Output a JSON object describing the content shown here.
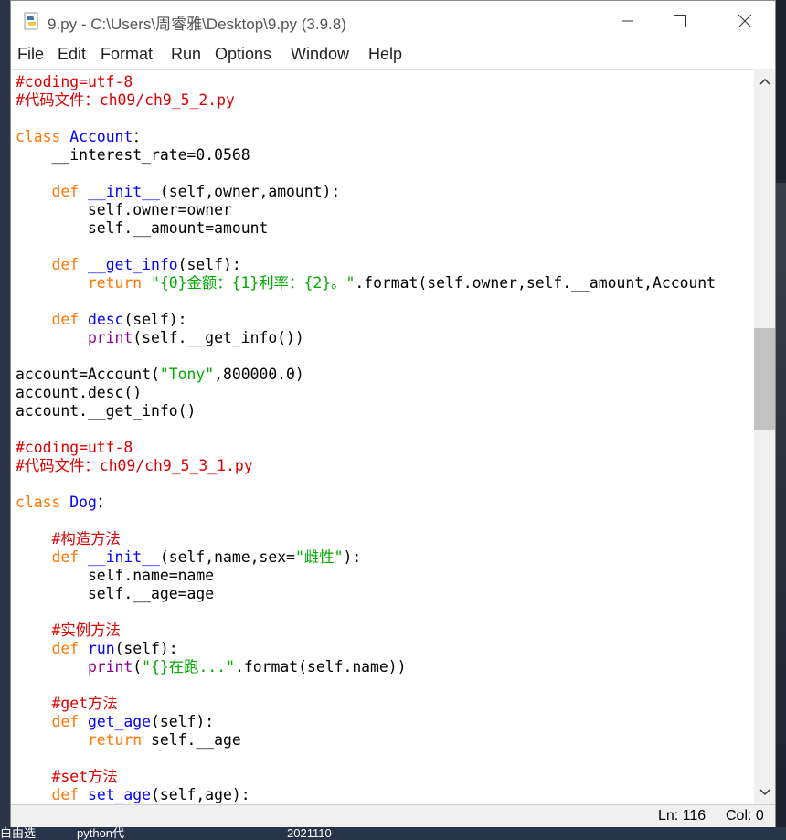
{
  "window": {
    "title": "9.py - C:\\Users\\周睿雅\\Desktop\\9.py (3.9.8)"
  },
  "menu": [
    "File",
    "Edit",
    "Format",
    "Run",
    "Options",
    "Window",
    "Help"
  ],
  "status": {
    "line": "Ln: 116",
    "col": "Col: 0"
  },
  "taskbar": {
    "items": [
      "白由选",
      "python代",
      "2021110"
    ]
  },
  "code_lines": [
    [
      [
        "cm",
        "#coding=utf-8"
      ]
    ],
    [
      [
        "cm",
        "#代码文件：ch09/ch9_5_2.py"
      ]
    ],
    [],
    [
      [
        "kw",
        "class "
      ],
      [
        "df",
        "Account"
      ],
      [
        "",
        "："
      ]
    ],
    [
      [
        "",
        "    __interest_rate=0.0568"
      ]
    ],
    [],
    [
      [
        "kw",
        "    def "
      ],
      [
        "df",
        "__init__"
      ],
      [
        "",
        "(self,owner,amount):"
      ]
    ],
    [
      [
        "",
        "        self.owner=owner"
      ]
    ],
    [
      [
        "",
        "        self.__amount=amount"
      ]
    ],
    [],
    [
      [
        "kw",
        "    def "
      ],
      [
        "df",
        "__get_info"
      ],
      [
        "",
        "(self):"
      ]
    ],
    [
      [
        "kw",
        "        return "
      ],
      [
        "st",
        "\"{0}金额：{1}利率：{2}。\""
      ],
      [
        "",
        ".format(self.owner,self.__amount,Account"
      ]
    ],
    [],
    [
      [
        "kw",
        "    def "
      ],
      [
        "df",
        "desc"
      ],
      [
        "",
        "(self):"
      ]
    ],
    [
      [
        "bi",
        "        print"
      ],
      [
        "",
        "(self.__get_info())"
      ]
    ],
    [],
    [
      [
        "",
        "account=Account("
      ],
      [
        "st",
        "\"Tony\""
      ],
      [
        "",
        ",800000.0)"
      ]
    ],
    [
      [
        "",
        "account.desc()"
      ]
    ],
    [
      [
        "",
        "account.__get_info()"
      ]
    ],
    [],
    [
      [
        "cm",
        "#coding=utf-8"
      ]
    ],
    [
      [
        "cm",
        "#代码文件：ch09/ch9_5_3_1.py"
      ]
    ],
    [],
    [
      [
        "kw",
        "class "
      ],
      [
        "df",
        "Dog"
      ],
      [
        "",
        "："
      ]
    ],
    [],
    [
      [
        "cm",
        "    #构造方法"
      ]
    ],
    [
      [
        "kw",
        "    def "
      ],
      [
        "df",
        "__init__"
      ],
      [
        "",
        "(self,name,sex="
      ],
      [
        "st",
        "\"雌性\""
      ],
      [
        "",
        "):"
      ]
    ],
    [
      [
        "",
        "        self.name=name"
      ]
    ],
    [
      [
        "",
        "        self.__age=age"
      ]
    ],
    [],
    [
      [
        "cm",
        "    #实例方法"
      ]
    ],
    [
      [
        "kw",
        "    def "
      ],
      [
        "df",
        "run"
      ],
      [
        "",
        "(self):"
      ]
    ],
    [
      [
        "bi",
        "        print"
      ],
      [
        "",
        "("
      ],
      [
        "st",
        "\"{}在跑...\""
      ],
      [
        "",
        ".format(self.name))"
      ]
    ],
    [],
    [
      [
        "cm",
        "    #get方法"
      ]
    ],
    [
      [
        "kw",
        "    def "
      ],
      [
        "df",
        "get_age"
      ],
      [
        "",
        "(self):"
      ]
    ],
    [
      [
        "kw",
        "        return "
      ],
      [
        "",
        "self.__age"
      ]
    ],
    [],
    [
      [
        "cm",
        "    #set方法"
      ]
    ],
    [
      [
        "kw",
        "    def "
      ],
      [
        "df",
        "set_age"
      ],
      [
        "",
        "(self,age):"
      ]
    ]
  ]
}
